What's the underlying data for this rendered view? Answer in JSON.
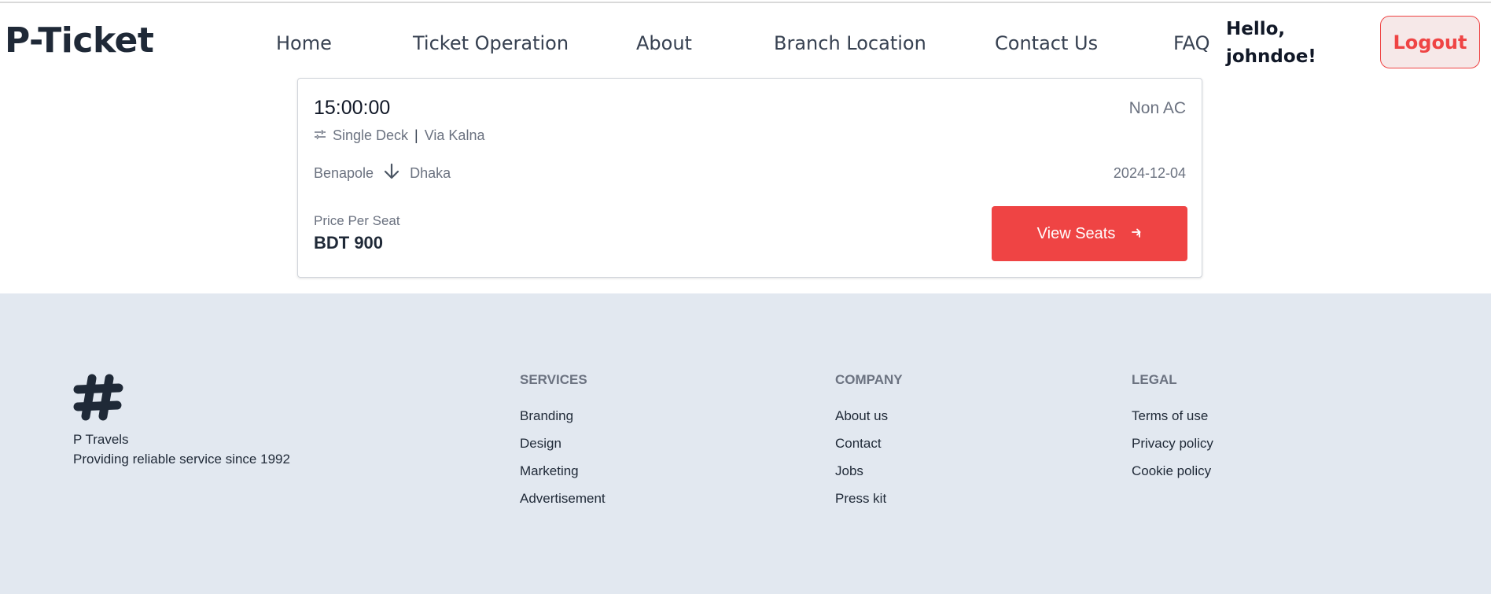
{
  "header": {
    "logo": "P-Ticket",
    "nav": [
      "Home",
      "Ticket Operation",
      "About",
      "Branch Location",
      "Contact Us",
      "FAQ"
    ],
    "greeting_line1": "Hello,",
    "greeting_line2": "johndoe!",
    "logout_label": "Logout"
  },
  "trip": {
    "time": "15:00:00",
    "ac_type": "Non AC",
    "deck": "Single Deck",
    "separator": "|",
    "via": "Via Kalna",
    "from": "Benapole",
    "to": "Dhaka",
    "date": "2024-12-04",
    "price_label": "Price Per Seat",
    "price": "BDT 900",
    "button_label": "View Seats"
  },
  "footer": {
    "brand_name": "P Travels",
    "brand_tagline": "Providing reliable service since 1992",
    "columns": [
      {
        "title": "SERVICES",
        "links": [
          "Branding",
          "Design",
          "Marketing",
          "Advertisement"
        ]
      },
      {
        "title": "COMPANY",
        "links": [
          "About us",
          "Contact",
          "Jobs",
          "Press kit"
        ]
      },
      {
        "title": "LEGAL",
        "links": [
          "Terms of use",
          "Privacy policy",
          "Cookie policy"
        ]
      }
    ]
  },
  "colors": {
    "accent": "#ef4444",
    "footer_bg": "#e2e8f0",
    "text_dark": "#1f2937",
    "text_muted": "#6b7280"
  }
}
